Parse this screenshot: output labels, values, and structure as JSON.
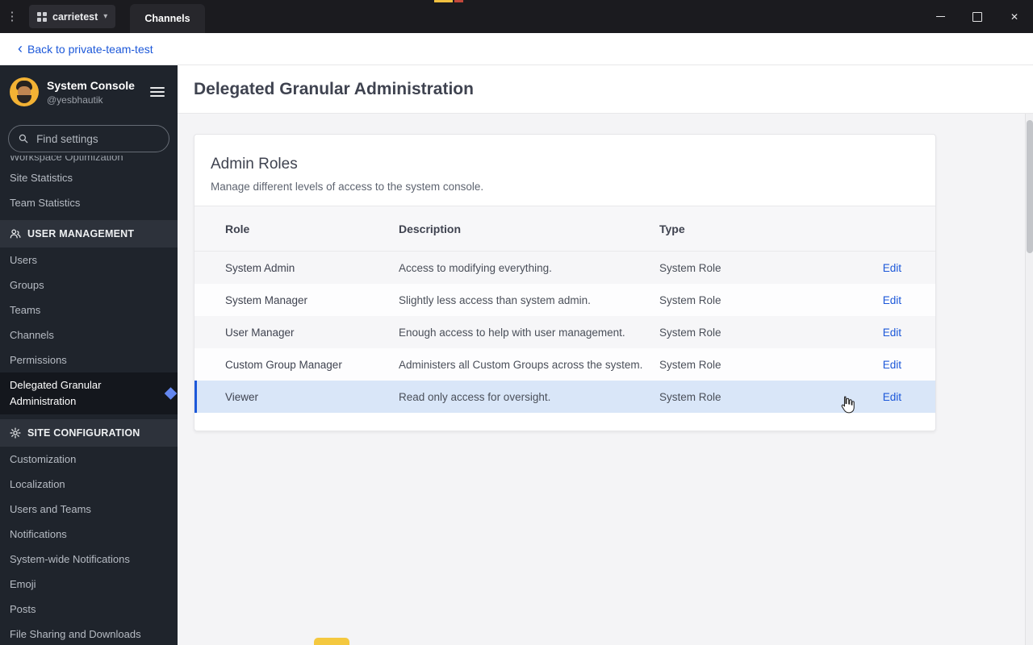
{
  "colors": {
    "accent": "#1c58d9",
    "titlebar_bg": "#1b1b1f",
    "sidebar_bg": "#1f242c",
    "section_bg": "#2d323b",
    "active_bg": "#14171d",
    "avatar_bg": "#f3b234",
    "highlight_row": "#d9e6f8"
  },
  "icons": {
    "kebab-menu": "⋮",
    "server-grid": "2x2-squares",
    "chevron-down": "▾",
    "back-chevron": "‹",
    "hamburger": "3-bars",
    "search": "magnifier-svg",
    "minimize": "line",
    "maximize": "square",
    "close": "✕",
    "user-management": "person-svg",
    "site-configuration": "gear-svg",
    "active-pointer": "diamond",
    "cursor": "hand-pointer-svg"
  },
  "titlebar": {
    "server_name": "carrietest",
    "tab": "Channels"
  },
  "backbar": {
    "label": "Back to private-team-test"
  },
  "sidebar": {
    "title": "System Console",
    "subtitle": "@yesbhautik",
    "search_placeholder": "Find settings",
    "clipped_item": "Workspace Optimization",
    "items_top": [
      "Site Statistics",
      "Team Statistics"
    ],
    "section_user_management": "USER MANAGEMENT",
    "items_user_management": [
      "Users",
      "Groups",
      "Teams",
      "Channels",
      "Permissions"
    ],
    "active_item": "Delegated Granular Administration",
    "section_site_configuration": "SITE CONFIGURATION",
    "items_site_configuration": [
      "Customization",
      "Localization",
      "Users and Teams",
      "Notifications",
      "System-wide Notifications",
      "Emoji",
      "Posts",
      "File Sharing and Downloads"
    ]
  },
  "main": {
    "page_title": "Delegated Granular Administration",
    "card_title": "Admin Roles",
    "card_description": "Manage different levels of access to the system console.",
    "table": {
      "columns": [
        "Role",
        "Description",
        "Type"
      ],
      "edit_label": "Edit",
      "rows": [
        {
          "role": "System Admin",
          "description": "Access to modifying everything.",
          "type": "System Role"
        },
        {
          "role": "System Manager",
          "description": "Slightly less access than system admin.",
          "type": "System Role"
        },
        {
          "role": "User Manager",
          "description": "Enough access to help with user management.",
          "type": "System Role"
        },
        {
          "role": "Custom Group Manager",
          "description": "Administers all Custom Groups across the system.",
          "type": "System Role"
        },
        {
          "role": "Viewer",
          "description": "Read only access for oversight.",
          "type": "System Role"
        }
      ]
    }
  }
}
